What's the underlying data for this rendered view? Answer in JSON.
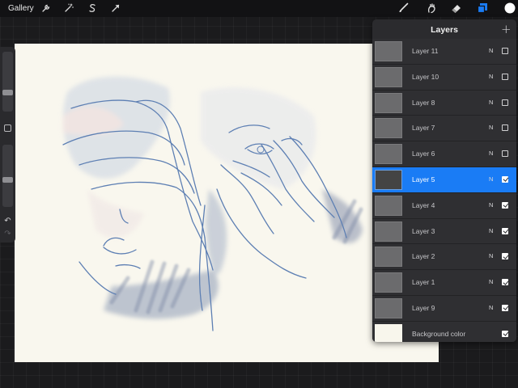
{
  "toolbar": {
    "gallery_label": "Gallery",
    "left_icons": [
      "wrench-icon",
      "magic-wand-icon",
      "selection-s-icon",
      "transform-arrow-icon"
    ],
    "right_icons": [
      "brush-icon",
      "smudge-icon",
      "eraser-icon",
      "layers-icon",
      "color-swatch-icon"
    ],
    "active_color": "#1a7cf5",
    "swatch_color": "#ffffff"
  },
  "sidebar": {
    "brush_size_level": 0.7,
    "opacity_level": 0.45,
    "undo_glyph": "↶",
    "redo_glyph": "↷"
  },
  "layers_panel": {
    "title": "Layers",
    "add_glyph": "+",
    "layers": [
      {
        "name": "Layer 11",
        "blend": "N",
        "visible": false,
        "selected": false
      },
      {
        "name": "Layer 10",
        "blend": "N",
        "visible": false,
        "selected": false
      },
      {
        "name": "Layer 8",
        "blend": "N",
        "visible": false,
        "selected": false
      },
      {
        "name": "Layer 7",
        "blend": "N",
        "visible": false,
        "selected": false
      },
      {
        "name": "Layer 6",
        "blend": "N",
        "visible": false,
        "selected": false
      },
      {
        "name": "Layer 5",
        "blend": "N",
        "visible": true,
        "selected": true
      },
      {
        "name": "Layer 4",
        "blend": "N",
        "visible": true,
        "selected": false
      },
      {
        "name": "Layer 3",
        "blend": "N",
        "visible": true,
        "selected": false
      },
      {
        "name": "Layer 2",
        "blend": "N",
        "visible": true,
        "selected": false
      },
      {
        "name": "Layer 1",
        "blend": "N",
        "visible": true,
        "selected": false
      },
      {
        "name": "Layer 9",
        "blend": "N",
        "visible": true,
        "selected": false
      }
    ],
    "background": {
      "name": "Background color",
      "visible": true
    }
  },
  "canvas": {
    "paper_color": "#f9f7ee",
    "wash_color": "#a8b3c7",
    "line_color": "#5d7fb3"
  }
}
